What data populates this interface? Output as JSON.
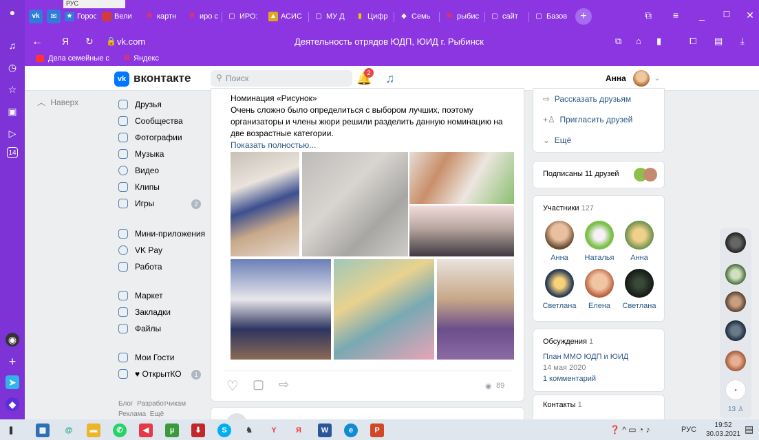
{
  "browser": {
    "tabs": [
      {
        "label": "Горос",
        "color": "#2f7dd9"
      },
      {
        "label": "Вели",
        "color": "#d23b3b"
      },
      {
        "label": "картн",
        "color": "#ff3333"
      },
      {
        "label": "иро с",
        "color": "#ff3333"
      },
      {
        "label": "ИРО:",
        "color": "#ffffff"
      },
      {
        "label": "АСИС",
        "color": "#e0a81c"
      },
      {
        "label": "МУ Д",
        "color": "#ffffff"
      },
      {
        "label": "Цифр",
        "color": "#f5c400"
      },
      {
        "label": "Семь",
        "color": "#ffffff"
      },
      {
        "label": "рыбис",
        "color": "#ff3333"
      },
      {
        "label": "сайт",
        "color": "#ffffff"
      },
      {
        "label": "Базов",
        "color": "#ffffff"
      }
    ],
    "address": "vk.com",
    "page_title": "Деятельность отрядов ЮДП, ЮИД г. Рыбинск",
    "bookmarks": [
      "Дела семейные с",
      "Яндекс"
    ],
    "top_tray": "РУС"
  },
  "vk": {
    "logo": "вконтакте",
    "search_placeholder": "Поиск",
    "notif_count": "2",
    "user_name": "Анна",
    "back_label": "Наверх",
    "menu": [
      {
        "label": "Друзья"
      },
      {
        "label": "Сообщества"
      },
      {
        "label": "Фотографии"
      },
      {
        "label": "Музыка"
      },
      {
        "label": "Видео"
      },
      {
        "label": "Клипы"
      },
      {
        "label": "Игры",
        "badge": "2"
      },
      {
        "label": "Мини-приложения"
      },
      {
        "label": "VK Pay"
      },
      {
        "label": "Работа"
      },
      {
        "label": "Маркет"
      },
      {
        "label": "Закладки"
      },
      {
        "label": "Файлы"
      },
      {
        "label": "Мои Гости"
      },
      {
        "label": "♥ ОткрытКО",
        "badge": "1"
      }
    ],
    "footer_links": [
      "Блог",
      "Разработчикам",
      "Реклама",
      "Ещё"
    ],
    "post": {
      "heading": "Номинация «Рисунок»",
      "body": "Очень сложно было определиться с выбором лучших, поэтому организаторы и члены жюри решили разделить данную номинацию на две возрастные категории.",
      "more": "Показать полностью...",
      "views": "89"
    },
    "right": {
      "tell_friends": "Рассказать друзьям",
      "invite": "Пригласить друзей",
      "more": "Ещё",
      "subscribed": "Подписаны 11 друзей",
      "members_title": "Участники",
      "members_count": "127",
      "members": [
        "Анна",
        "Наталья",
        "Анна",
        "Светлана",
        "Елена",
        "Светлана"
      ],
      "discussions_title": "Обсуждения",
      "discussions_count": "1",
      "topic": "План ММО ЮДП и ЮИД",
      "topic_date": "14 мая 2020",
      "topic_comments": "1 комментарий",
      "contacts_title": "Контакты",
      "contacts_count": "1"
    },
    "chat_count": "13"
  },
  "taskbar": {
    "lang": "РУС",
    "time": "19:52",
    "date": "30.03.2021"
  }
}
